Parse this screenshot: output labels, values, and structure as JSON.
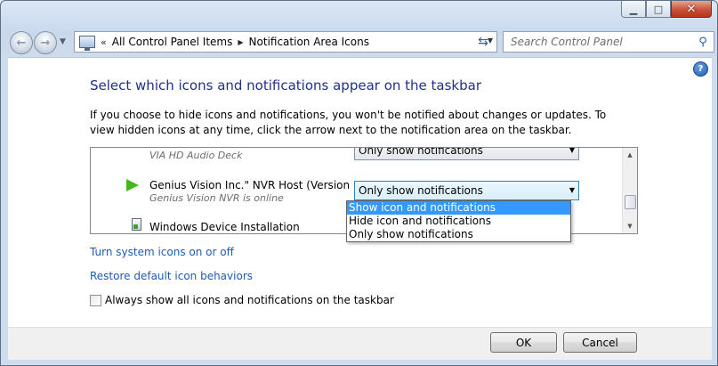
{
  "window": {
    "minimize_glyph": "▁",
    "maximize_glyph": "□",
    "close_glyph": "✕"
  },
  "navigation": {
    "back_icon": "back-arrow-icon",
    "forward_icon": "forward-arrow-icon",
    "address_chevron": "«",
    "breadcrumbs": [
      "All Control Panel Items",
      "Notification Area Icons"
    ],
    "breadcrumb_separator": "▶",
    "search_placeholder": "Search Control Panel"
  },
  "main": {
    "title": "Select which icons and notifications appear on the taskbar",
    "description": "If you choose to hide icons and notifications, you won't be notified about changes or updates. To view hidden icons at any time, click the arrow next to the notification area on the taskbar.",
    "icons_list": [
      {
        "name": "",
        "sub": "VIA HD Audio Deck",
        "behavior": "Only show notifications"
      },
      {
        "name": "Genius Vision Inc.\" NVR Host (Version ...",
        "sub": "Genius Vision NVR is online",
        "behavior": "Only show notifications"
      },
      {
        "name": "Windows Device Installation",
        "sub": "",
        "behavior": ""
      }
    ],
    "dropdown_options": [
      "Show icon and notifications",
      "Hide icon and notifications",
      "Only show notifications"
    ],
    "highlighted_option_index": 0,
    "links": {
      "system_icons": "Turn system icons on or off",
      "restore_defaults": "Restore default icon behaviors"
    },
    "always_show_label": "Always show all icons and notifications on the taskbar",
    "always_show_checked": false
  },
  "footer": {
    "ok_label": "OK",
    "cancel_label": "Cancel"
  },
  "colors": {
    "title_blue": "#1e3287",
    "link_blue": "#1e5bb5",
    "selection_blue": "#3399ff"
  }
}
